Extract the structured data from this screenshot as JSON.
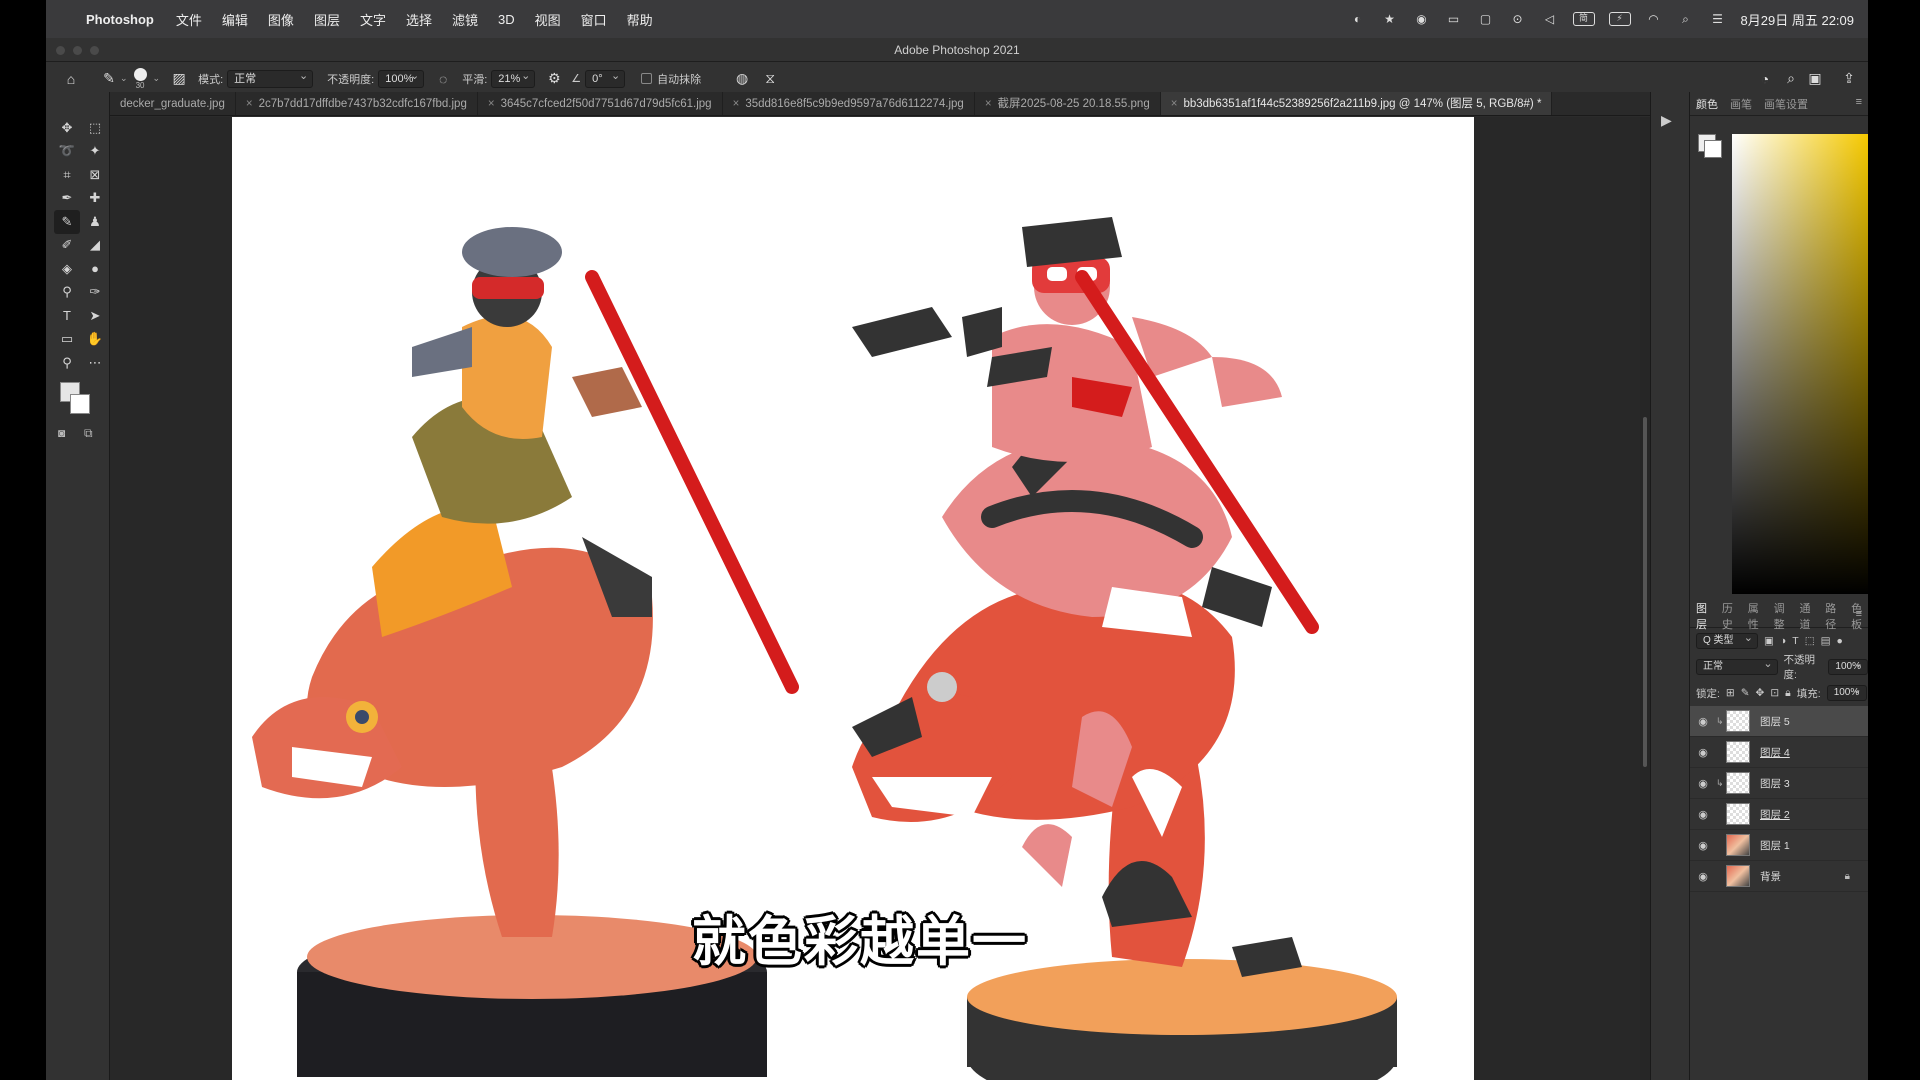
{
  "menubar": {
    "apple_icon": "apple-icon",
    "app": "Photoshop",
    "items": [
      "文件",
      "编辑",
      "图像",
      "图层",
      "文字",
      "选择",
      "滤镜",
      "3D",
      "视图",
      "窗口",
      "帮助"
    ],
    "clock": "8月29日 周五 22:09",
    "input_badge": "简"
  },
  "window": {
    "title": "Adobe Photoshop 2021"
  },
  "options": {
    "brush_size": "30",
    "mode_label": "模式:",
    "mode_value": "正常",
    "opacity_label": "不透明度:",
    "opacity_value": "100%",
    "smooth_label": "平滑:",
    "smooth_value": "21%",
    "angle_value": "0°",
    "auto_erase_label": "自动抹除"
  },
  "tabs": [
    {
      "label": "decker_graduate.jpg",
      "active": false
    },
    {
      "label": "2c7b7dd17dffdbe7437b32cdfc167fbd.jpg",
      "active": false
    },
    {
      "label": "3645c7cfced2f50d7751d67d79d5fc61.jpg",
      "active": false
    },
    {
      "label": "35dd816e8f5c9b9ed9597a76d6112274.jpg",
      "active": false
    },
    {
      "label": "截屏2025-08-25 20.18.55.png",
      "active": false
    },
    {
      "label": "bb3db6351af1f44c52389256f2a211b9.jpg @ 147% (图层 5, RGB/8#) *",
      "active": true
    }
  ],
  "canvas": {
    "subtitle": "就色彩越单一"
  },
  "color_panel": {
    "tabs": [
      "颜色",
      "画笔",
      "画笔设置"
    ]
  },
  "layers_panel": {
    "tabs": [
      "图层",
      "历史",
      "属性",
      "调整",
      "通道",
      "路径",
      "色板"
    ],
    "filter_label": "Q 类型",
    "blend_mode": "正常",
    "opacity_label": "不透明度:",
    "opacity_value": "100%",
    "lock_label": "锁定:",
    "fill_label": "填充:",
    "fill_value": "100%",
    "layers": [
      {
        "name": "图层 5",
        "selected": true,
        "clipped": true,
        "underline": false
      },
      {
        "name": "图层 4",
        "selected": false,
        "clipped": false,
        "underline": true
      },
      {
        "name": "图层 3",
        "selected": false,
        "clipped": true,
        "underline": false
      },
      {
        "name": "图层 2",
        "selected": false,
        "clipped": false,
        "underline": true
      },
      {
        "name": "图层 1",
        "selected": false,
        "clipped": false,
        "underline": false
      },
      {
        "name": "背景",
        "selected": false,
        "clipped": false,
        "underline": false,
        "locked": true
      }
    ]
  },
  "colors": {
    "figure_red": "#e2533d",
    "skin": "#f0a890",
    "pink": "#e88a8a",
    "dark": "#333333",
    "pole_red": "#d41c1c",
    "goggles": "#e23b3b",
    "base_orange": "#f2a05a"
  }
}
